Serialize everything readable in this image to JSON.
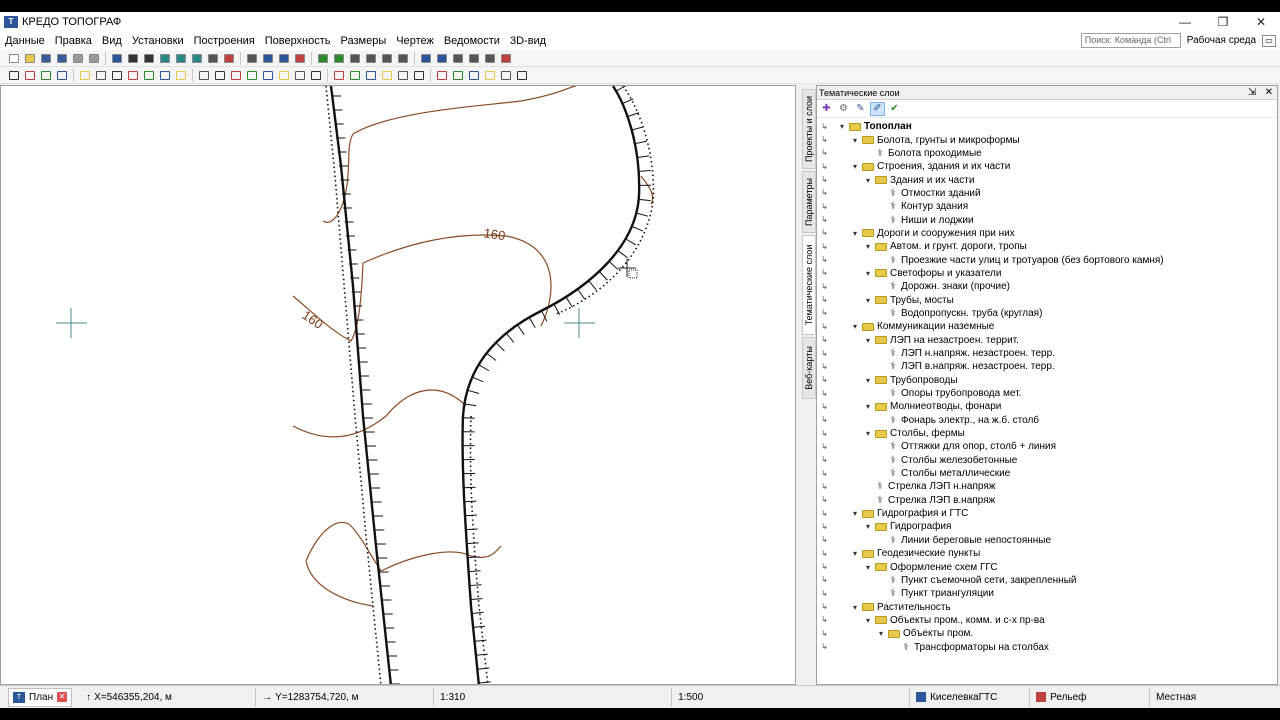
{
  "window": {
    "title": "КРЕДО ТОПОГРАФ",
    "app_icon": "Т",
    "minimize": "—",
    "maximize": "❐",
    "close": "✕"
  },
  "menu": {
    "items": [
      "Данные",
      "Правка",
      "Вид",
      "Установки",
      "Построения",
      "Поверхность",
      "Размеры",
      "Чертеж",
      "Ведомости",
      "3D-вид"
    ],
    "search_placeholder": "Поиск: Команда (Ctrl ...",
    "workspace": "Рабочая среда"
  },
  "canvas": {
    "contour_labels": [
      "160",
      "160"
    ]
  },
  "side_tabs": [
    "Проекты и слои",
    "Параметры",
    "Тематические слои",
    "Веб-карты"
  ],
  "panel": {
    "title": "Тематические слои",
    "pin": "⇲",
    "close": "✕",
    "tree": [
      {
        "level": 0,
        "type": "folder",
        "expand": "▾",
        "label": "Топоплан",
        "bold": true
      },
      {
        "level": 1,
        "type": "folder",
        "expand": "▾",
        "label": "Болота, грунты и микроформы"
      },
      {
        "level": 2,
        "type": "leaf",
        "label": "Болота проходимые"
      },
      {
        "level": 1,
        "type": "folder",
        "expand": "▾",
        "label": "Строения, здания и их части"
      },
      {
        "level": 2,
        "type": "folder",
        "expand": "▾",
        "label": "Здания и их части"
      },
      {
        "level": 3,
        "type": "leaf",
        "label": "Отмостки зданий"
      },
      {
        "level": 3,
        "type": "leaf",
        "label": "Контур здания"
      },
      {
        "level": 3,
        "type": "leaf",
        "label": "Ниши и лоджии"
      },
      {
        "level": 1,
        "type": "folder",
        "expand": "▾",
        "label": "Дороги и сооружения при них"
      },
      {
        "level": 2,
        "type": "folder",
        "expand": "▾",
        "label": "Автом. и грунт. дороги, тропы"
      },
      {
        "level": 3,
        "type": "leaf",
        "label": "Проезжие части улиц и тротуаров (без бортового камня)"
      },
      {
        "level": 2,
        "type": "folder",
        "expand": "▾",
        "label": "Светофоры и указатели"
      },
      {
        "level": 3,
        "type": "leaf",
        "label": "Дорожн. знаки (прочие)"
      },
      {
        "level": 2,
        "type": "folder",
        "expand": "▾",
        "label": "Трубы, мосты"
      },
      {
        "level": 3,
        "type": "leaf",
        "label": "Водопропускн. труба (круглая)"
      },
      {
        "level": 1,
        "type": "folder",
        "expand": "▾",
        "label": "Коммуникации наземные"
      },
      {
        "level": 2,
        "type": "folder",
        "expand": "▾",
        "label": "ЛЭП на незастроен. террит."
      },
      {
        "level": 3,
        "type": "leaf",
        "label": "ЛЭП н.напряж. незастроен. терр."
      },
      {
        "level": 3,
        "type": "leaf",
        "label": "ЛЭП в.напряж. незастроен. терр."
      },
      {
        "level": 2,
        "type": "folder",
        "expand": "▾",
        "label": "Трубопроводы"
      },
      {
        "level": 3,
        "type": "leaf",
        "label": "Опоры трубопровода мет."
      },
      {
        "level": 2,
        "type": "folder",
        "expand": "▾",
        "label": "Молниеотводы, фонари"
      },
      {
        "level": 3,
        "type": "leaf",
        "label": "Фонарь электр., на ж.б. столб"
      },
      {
        "level": 2,
        "type": "folder",
        "expand": "▾",
        "label": "Столбы, фермы"
      },
      {
        "level": 3,
        "type": "leaf",
        "label": "Оттяжки для опор, столб + линия"
      },
      {
        "level": 3,
        "type": "leaf",
        "label": "Столбы железобетонные"
      },
      {
        "level": 3,
        "type": "leaf",
        "label": "Столбы металлические"
      },
      {
        "level": 2,
        "type": "leaf",
        "label": "Стрелка ЛЭП н.напряж"
      },
      {
        "level": 2,
        "type": "leaf",
        "label": "Стрелка ЛЭП в.напряж"
      },
      {
        "level": 1,
        "type": "folder",
        "expand": "▾",
        "label": "Гидрография и ГТС"
      },
      {
        "level": 2,
        "type": "folder",
        "expand": "▾",
        "label": "Гидрография"
      },
      {
        "level": 3,
        "type": "leaf",
        "label": "Линии береговые непостоянные"
      },
      {
        "level": 1,
        "type": "folder",
        "expand": "▾",
        "label": "Геодезические пункты"
      },
      {
        "level": 2,
        "type": "folder",
        "expand": "▾",
        "label": "Оформление схем ГГС"
      },
      {
        "level": 3,
        "type": "leaf",
        "label": "Пункт съемочной сети, закрепленный"
      },
      {
        "level": 3,
        "type": "leaf",
        "label": "Пункт триангуляции"
      },
      {
        "level": 1,
        "type": "folder",
        "expand": "▾",
        "label": "Растительность"
      },
      {
        "level": 2,
        "type": "folder",
        "expand": "▾",
        "label": "Объекты пром., комм. и с-х пр-ва"
      },
      {
        "level": 3,
        "type": "folder",
        "expand": "▾",
        "label": "Объекты пром."
      },
      {
        "level": 4,
        "type": "leaf",
        "label": "Трансформаторы на столбах"
      }
    ]
  },
  "status": {
    "tab": "План",
    "x_coord": "X=546355,204, м",
    "y_coord": "Y=1283754,720, м",
    "scale1": "1:310",
    "scale2": "1:500",
    "project": "КиселевкаГТС",
    "surface": "Рельеф",
    "system": "Местная"
  }
}
